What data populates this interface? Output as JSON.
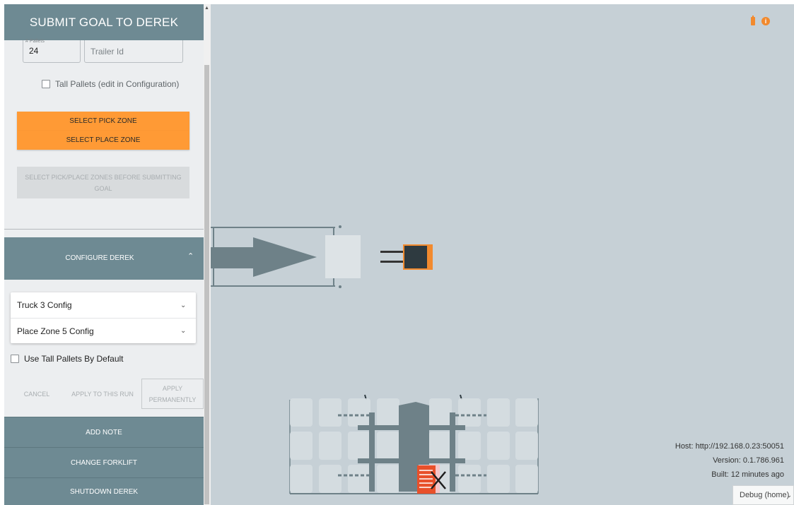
{
  "goal_panel": {
    "title": "SUBMIT GOAL TO DEREK",
    "pallets_label": "# Pallets",
    "pallets_value": "24",
    "trailer_placeholder": "Trailer Id",
    "tall_pallets_label": "Tall Pallets (edit in Configuration)",
    "select_pick_zone": "SELECT PICK ZONE",
    "select_place_zone": "SELECT PLACE ZONE",
    "submit_disabled": "SELECT PICK/PLACE ZONES BEFORE SUBMITTING GOAL"
  },
  "configure": {
    "title": "CONFIGURE DEREK",
    "truck_config": "Truck 3 Config",
    "place_zone_config": "Place Zone 5 Config",
    "use_tall_pallets": "Use Tall Pallets By Default",
    "cancel": "CANCEL",
    "apply_run": "APPLY TO THIS RUN",
    "apply_permanently": "APPLY PERMANENTLY"
  },
  "actions": {
    "add_note": "ADD NOTE",
    "change_forklift": "CHANGE FORKLIFT",
    "shutdown": "SHUTDOWN DEREK"
  },
  "status": {
    "host": "Host: http://192.168.0.23:50051",
    "version": "Version: 0.1.786.961",
    "built": "Built: 12 minutes ago",
    "mode": "Debug (home)"
  },
  "colors": {
    "accent": "#ff9a35",
    "header": "#6e8a93",
    "map_bg": "#c6d0d6",
    "alert": "#e8502a"
  },
  "icons": {
    "top_right": [
      "battery-icon",
      "info-icon"
    ],
    "dropdown": "chevron-down-icon",
    "collapse": "chevron-up-icon"
  }
}
